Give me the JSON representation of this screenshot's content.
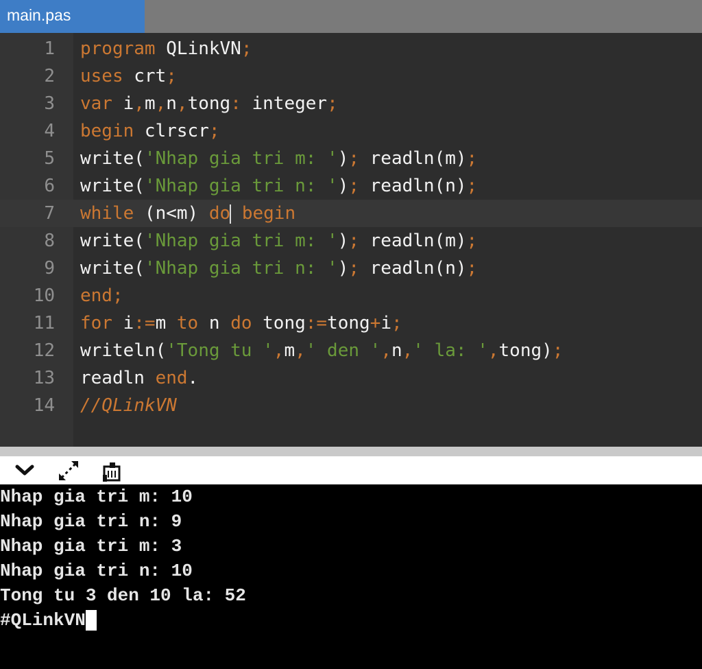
{
  "tab": {
    "label": "main.pas"
  },
  "editor": {
    "line_numbers": [
      "1",
      "2",
      "3",
      "4",
      "5",
      "6",
      "7",
      "8",
      "9",
      "10",
      "11",
      "12",
      "13",
      "14"
    ],
    "tokens": {
      "program": "program",
      "progname": " QLinkVN",
      "semi": ";",
      "uses": "uses",
      "crt": " crt",
      "var": "var",
      "vars": " i",
      "comma": ",",
      "m": "m",
      "n": "n",
      "tong": "tong",
      "colon": ":",
      "integer": " integer",
      "begin": "begin",
      "clrscr": " clrscr",
      "write": "write(",
      "str_m": "'Nhap gia tri m: '",
      "str_n": "'Nhap gia tri n: '",
      "close": ")",
      "readln_m": " readln(m)",
      "readln_n": " readln(n)",
      "while": "while",
      "cond": " (n<m) ",
      "do": "do",
      "begin2": " begin",
      "end_semi": "end;",
      "for": "for",
      "i": " i",
      "assign": ":=",
      "to": " to",
      "n_sp": " n ",
      "tongsp": " tong",
      "tong2": "tong",
      "plus": "+",
      "i2": "i",
      "writeln": "writeln(",
      "str_tong": "'Tong tu '",
      "str_den": "' den '",
      "str_la": "' la: '",
      "tong_close": "tong)",
      "readln": "readln ",
      "end_dot": "end",
      "dot": ".",
      "comment": "//QLinkVN"
    }
  },
  "console_toolbar": {
    "collapse_icon": "chevron-down-icon",
    "expand_icon": "expand-icon",
    "clear_icon": "clear-console-icon"
  },
  "terminal": {
    "lines": [
      "Nhap gia tri m: 10",
      "Nhap gia tri n: 9",
      "Nhap gia tri m: 3",
      "Nhap gia tri n: 10",
      "Tong tu 3 den 10 la: 52",
      "#QLinkVN"
    ]
  },
  "colors": {
    "keyword": "#cc7832",
    "string": "#6a9a3a",
    "tab_active": "#3e7dc6",
    "editor_bg": "#2d2d2d"
  }
}
